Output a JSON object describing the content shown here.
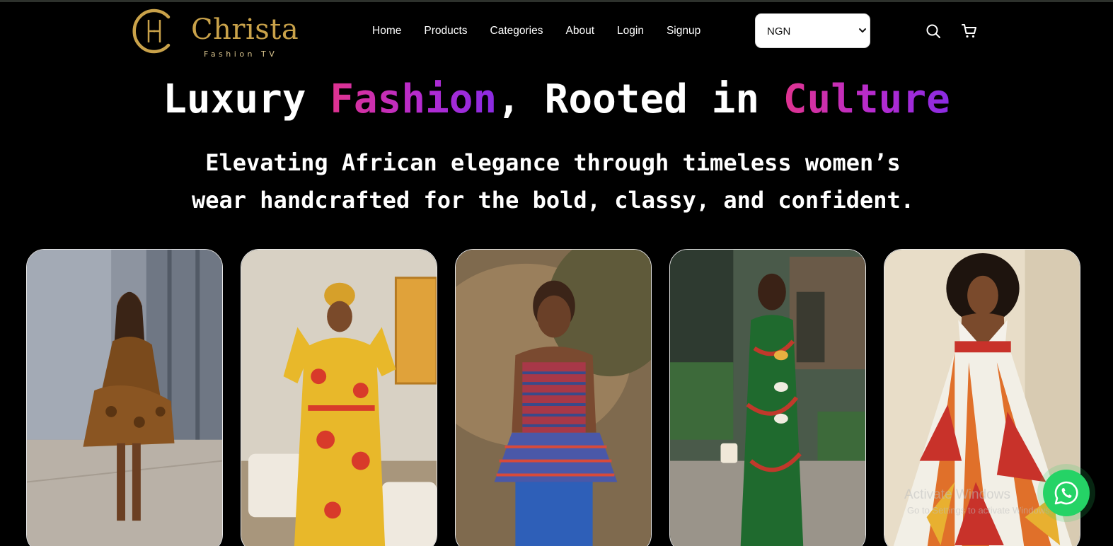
{
  "brand": {
    "name": "Christa",
    "tagline": "Fashion TV",
    "colors": {
      "gold": "#c9a24a",
      "accent_pink": "#e0338f",
      "accent_purple": "#8a2be2"
    }
  },
  "nav": {
    "items": [
      {
        "label": "Home"
      },
      {
        "label": "Products"
      },
      {
        "label": "Categories"
      },
      {
        "label": "About"
      },
      {
        "label": "Login"
      },
      {
        "label": "Signup"
      }
    ]
  },
  "currency": {
    "selected": "NGN",
    "icon": "chevron-down-icon"
  },
  "header_icons": {
    "search": "search-icon",
    "cart": "cart-icon"
  },
  "hero": {
    "title": {
      "part1": "Luxury ",
      "highlight1": "Fashion",
      "part2": ", Rooted in ",
      "highlight2": "Culture"
    },
    "subtitle_line1": "Elevating African elegance through timeless women’s",
    "subtitle_line2": "wear handcrafted for the bold, classy, and confident."
  },
  "gallery": {
    "images": [
      {
        "name": "model-photo-1"
      },
      {
        "name": "model-photo-2"
      },
      {
        "name": "model-photo-3"
      },
      {
        "name": "model-photo-4"
      },
      {
        "name": "model-photo-5"
      }
    ]
  },
  "watermark": {
    "title": "Activate Windows",
    "subtitle": "Go to Settings to activate Windows."
  },
  "whatsapp": {
    "icon": "whatsapp-icon",
    "color": "#25d366"
  }
}
